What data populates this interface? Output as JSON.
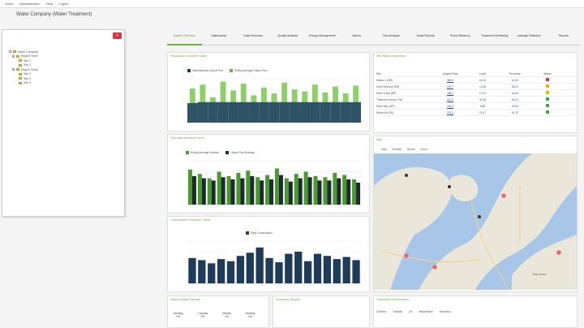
{
  "topbar": {
    "links": [
      "Home",
      "Administration",
      "Help",
      "Logout"
    ]
  },
  "page": {
    "title": "Water Company (Water Treatment)"
  },
  "tree": {
    "close_label": "×",
    "nodes": [
      {
        "label": "Water Company",
        "level": 0
      },
      {
        "label": "Region North",
        "level": 1
      },
      {
        "label": "Site 1",
        "level": 2
      },
      {
        "label": "Site 2",
        "level": 2
      },
      {
        "label": "Region South",
        "level": 1
      },
      {
        "label": "Site 3",
        "level": 2
      },
      {
        "label": "Site 4",
        "level": 2
      },
      {
        "label": "Site 5",
        "level": 2
      }
    ]
  },
  "tabs": [
    {
      "label": "System Overview",
      "active": true
    },
    {
      "label": "Dashboards"
    },
    {
      "label": "Daily Summary"
    },
    {
      "label": "Quality Analysis"
    },
    {
      "label": "Energy Management"
    },
    {
      "label": "Alarms"
    },
    {
      "label": "Flow Analysis"
    },
    {
      "label": "Asset Reports"
    },
    {
      "label": "Pump Efficiency"
    },
    {
      "label": "Treatment Monitoring"
    },
    {
      "label": "Leakage Detection"
    },
    {
      "label": "Reports"
    }
  ],
  "panels": {
    "p1_title": "Production Volumes Today",
    "p1_legend": [
      "Instantaneous Output Flow",
      "Rolling Average Output Flow"
    ],
    "p2_title": "Flow and Demand Trend",
    "p2_legend": [
      "Rolling Average Demand",
      "Output Flow Average"
    ],
    "p3_title": "Consumption Volumes Today",
    "p3_legend": [
      "Daily Consumption"
    ],
    "p4_title": "Site Status Summary",
    "p5_title": "Map",
    "p6_title": "Water Quality Results",
    "p7_title": "Summary Targets",
    "p8_title": "Treatment Performance"
  },
  "table": {
    "headers": [
      "Site",
      "Output Flow",
      "Level",
      "Pressure",
      "Status"
    ],
    "rows": [
      {
        "site": "Station 1 (BR)",
        "flow": "365.9",
        "level": "24.10",
        "pressure": "61.84",
        "status": "red"
      },
      {
        "site": "East Reservoir (KR)",
        "flow": "201.7",
        "level": "12.55",
        "pressure": "58.21",
        "status": "amber"
      },
      {
        "site": "North Pump (NP)",
        "flow": "188.4",
        "level": "17.03",
        "pressure": "44.90",
        "status": "amber"
      },
      {
        "site": "Treatment Works (TW)",
        "flow": "412.0",
        "level": "31.66",
        "pressure": "66.12",
        "status": "green"
      },
      {
        "site": "West Tank (WT)",
        "flow": "154.3",
        "level": "9.88",
        "pressure": "39.45",
        "status": "green"
      },
      {
        "site": "Reservoir (RS)",
        "flow": "276.1",
        "level": "22.47",
        "pressure": "52.70",
        "status": "green"
      }
    ]
  },
  "map": {
    "toolbar": [
      "Map",
      "Satellite",
      "Terrain",
      "Zoom"
    ],
    "label": "Bay Area"
  },
  "bottom": {
    "stats": [
      {
        "name": "Monday",
        "value": "0%"
      },
      {
        "name": "Tuesday",
        "value": "0%"
      },
      {
        "name": "Weekly",
        "value": "0%"
      },
      {
        "name": "Monthly",
        "value": "0%"
      }
    ],
    "subtabs": [
      "Chlorine",
      "Turbidity",
      "pH",
      "Temperature",
      "Hardness"
    ]
  },
  "colors": {
    "accent_green": "#6bb33c",
    "light_green": "#8fcf6a",
    "dark_teal": "#2d5364",
    "navy": "#1f3b5a",
    "red": "#d9363e",
    "amber": "#e8b800"
  },
  "chart_data": [
    {
      "type": "bar",
      "title": "Production Volumes Today",
      "series": [
        {
          "name": "Instantaneous Output Flow",
          "values": [
            3.5,
            3.9,
            2.6,
            4.2,
            3.3,
            4.0,
            2.8,
            3.6,
            3.0,
            4.1,
            3.4,
            3.2,
            3.9,
            3.1,
            3.7,
            3.0,
            3.8
          ]
        },
        {
          "name": "Rolling Average Output Flow",
          "values": [
            2.0,
            2.1,
            2.1,
            2.1,
            2.1,
            2.1,
            2.1,
            2.1,
            2.1,
            2.1,
            2.1,
            2.1,
            2.1,
            2.1,
            2.1,
            2.1,
            2.1
          ]
        }
      ],
      "ylim": [
        0,
        4.5
      ]
    },
    {
      "type": "bar",
      "title": "Flow and Demand Trend",
      "series": [
        {
          "name": "Rolling Average Demand",
          "values": [
            3.2,
            2.8,
            2.4,
            3.0,
            2.6,
            2.9,
            3.1,
            2.5,
            2.7,
            3.3,
            2.4,
            2.8,
            3.0,
            2.6,
            2.5,
            2.9,
            2.7,
            2.3
          ]
        },
        {
          "name": "Output Flow Average",
          "values": [
            2.6,
            2.4,
            2.2,
            2.5,
            2.3,
            2.4,
            2.6,
            2.2,
            2.3,
            2.7,
            2.1,
            2.4,
            2.5,
            2.2,
            2.2,
            2.4,
            2.3,
            2.0
          ]
        }
      ],
      "ylim": [
        0,
        4
      ]
    },
    {
      "type": "bar",
      "title": "Consumption Volumes Today",
      "series": [
        {
          "name": "Daily Consumption",
          "values": [
            2.4,
            2.2,
            1.9,
            2.3,
            2.1,
            2.6,
            2.9,
            3.4,
            2.4,
            2.0,
            2.8,
            3.0,
            2.1,
            2.8,
            2.6,
            2.3,
            2.5,
            2.2
          ]
        }
      ],
      "ylim": [
        0,
        4
      ]
    }
  ]
}
